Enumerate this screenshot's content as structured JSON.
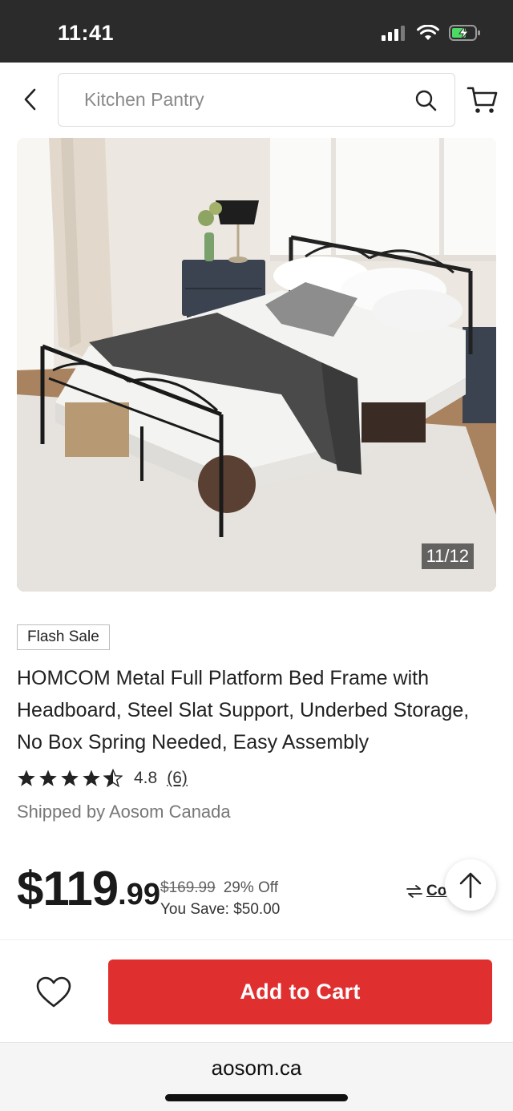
{
  "status_bar": {
    "time": "11:41",
    "signal_icon": "cellular-signal-icon",
    "wifi_icon": "wifi-icon",
    "battery_icon": "battery-charging-icon"
  },
  "header": {
    "back_icon": "chevron-left-icon",
    "search_placeholder": "Kitchen Pantry",
    "search_icon": "search-icon",
    "cart_icon": "shopping-cart-icon"
  },
  "gallery": {
    "counter": "11/12"
  },
  "product": {
    "badge": "Flash Sale",
    "title": "HOMCOM Metal Full Platform Bed Frame with Headboard, Steel Slat Support, Underbed Storage, No Box Spring Needed, Easy Assembly",
    "rating": "4.8",
    "rating_stars": 4.8,
    "review_count": "(6)",
    "shipped_by": "Shipped by Aosom Canada"
  },
  "price": {
    "whole": "$119",
    "cents": ".99",
    "original": "$169.99",
    "discount": "29% Off",
    "savings": "You Save: $50.00",
    "compare_label": "Co"
  },
  "actions": {
    "wishlist_icon": "heart-icon",
    "add_to_cart_label": "Add to Cart",
    "scroll_top_icon": "arrow-up-icon"
  },
  "browser": {
    "domain": "aosom.ca"
  },
  "colors": {
    "accent": "#e02f2f",
    "status_bar": "#2b2b2b"
  }
}
